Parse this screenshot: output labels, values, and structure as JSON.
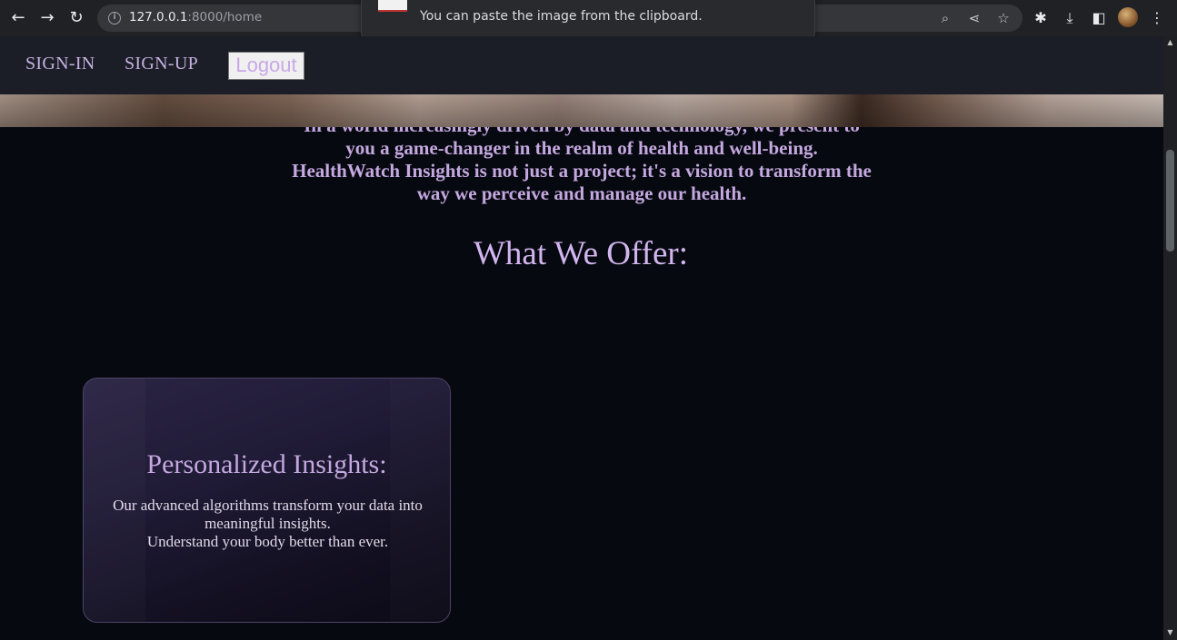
{
  "browser": {
    "url_host": "127.0.0.1",
    "url_path": ":8000/home",
    "back_icon": "arrow-left-icon",
    "forward_icon": "arrow-right-icon",
    "reload_icon": "reload-icon",
    "popup_text": "You can paste the image from the clipboard."
  },
  "nav": {
    "signin": "SIGN-IN",
    "signup": "SIGN-UP",
    "logout": "Logout"
  },
  "intro": {
    "text": "In a world increasingly driven by data and technology, we present to you a game-changer in the realm of health and well-being. HealthWatch Insights is not just a project; it's a vision to transform the way we perceive and manage our health."
  },
  "offer": {
    "title": "What We Offer:"
  },
  "card": {
    "title": "Personalized Insights:",
    "line1": "Our advanced algorithms transform your data into meaningful insights.",
    "line2": "Understand your body better than ever."
  }
}
